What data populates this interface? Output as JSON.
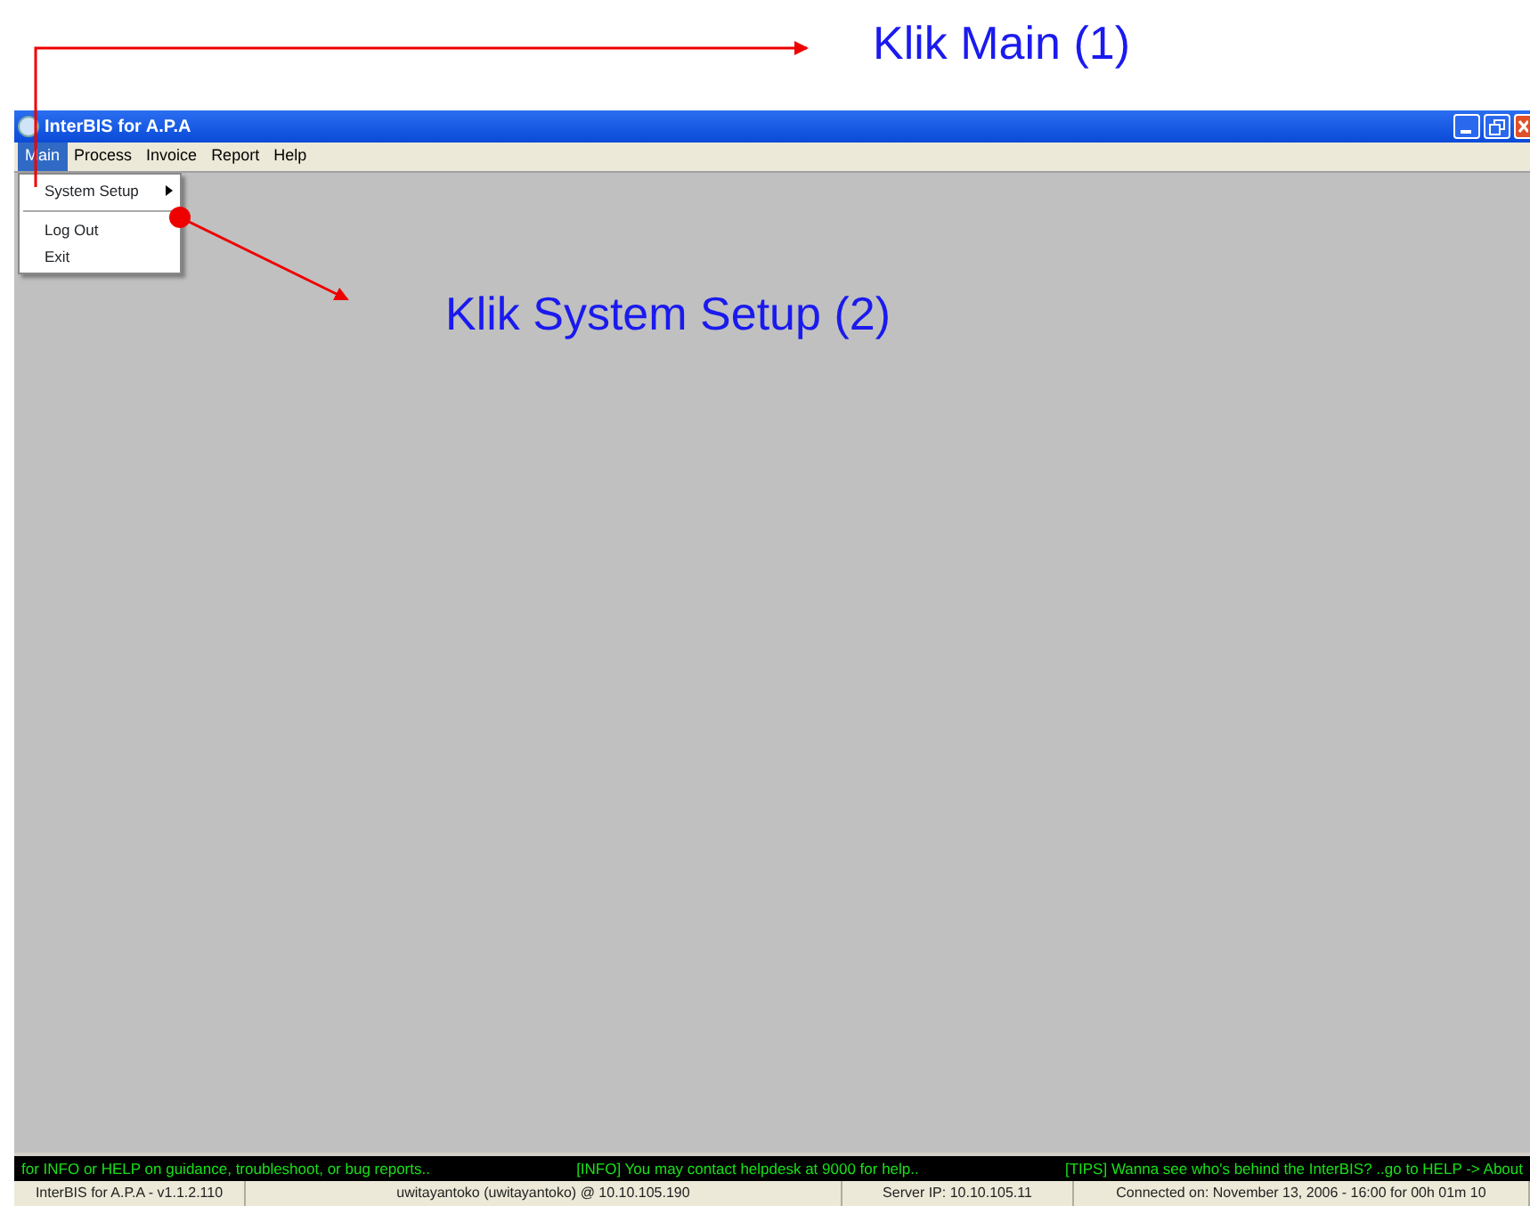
{
  "annotations": [
    {
      "text": "Klik Main (1)"
    },
    {
      "text": "Klik System Setup (2)"
    }
  ],
  "window": {
    "title": "InterBIS for A.P.A"
  },
  "menu": [
    {
      "label": "Main",
      "selected": true
    },
    {
      "label": "Process",
      "selected": false
    },
    {
      "label": "Invoice",
      "selected": false
    },
    {
      "label": "Report",
      "selected": false
    },
    {
      "label": "Help",
      "selected": false
    }
  ],
  "dropdown": [
    {
      "kind": "submenu",
      "label": "System Setup"
    },
    {
      "kind": "separator"
    },
    {
      "kind": "item",
      "label": "Log Out"
    },
    {
      "kind": "item",
      "label": "Exit"
    }
  ],
  "ticker": [
    "for INFO or HELP on guidance, troubleshoot, or bug reports..",
    "[INFO] You may contact helpdesk at 9000 for help..",
    "[TIPS] Wanna see who's behind the InterBIS? ..go to HELP -> About"
  ],
  "status_bar": [
    "InterBIS for A.P.A - v1.1.2.110",
    "uwitayantoko (uwitayantoko) @ 10.10.105.190",
    "Server IP: 10.10.105.11",
    "Connected on: November 13, 2006 - 16:00 for 00h 01m 10"
  ]
}
